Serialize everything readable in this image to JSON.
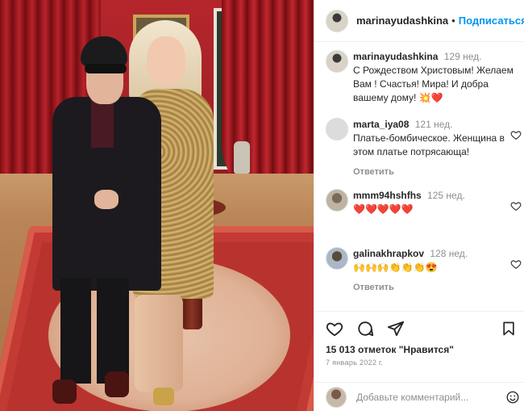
{
  "post": {
    "username": "marinayudashkina",
    "follow_label": "Подписаться",
    "separator": "•"
  },
  "comments": [
    {
      "username": "marinayudashkina",
      "time": "129 нед.",
      "text": "С Рождеством Христовым! Желаем Вам ! Счастья! Мира! И добра вашему дому! 💥❤️",
      "reply_label": ""
    },
    {
      "username": "marta_iya08",
      "time": "121 нед.",
      "text": "Платье-бомбическое. Женщина в этом платье потрясающа!",
      "reply_label": "Ответить"
    },
    {
      "username": "mmm94hshfhs",
      "time": "125 нед.",
      "text": "❤️❤️❤️❤️❤️",
      "reply_label": ""
    },
    {
      "username": "galinakhrapkov",
      "time": "128 нед.",
      "text": "🙌🙌🙌👏👏👏😍",
      "reply_label": "Ответить"
    }
  ],
  "actions": {
    "likes_text": "15 013 отметок \"Нравится\"",
    "date_text": "7 январь 2022 г."
  },
  "add_comment": {
    "placeholder": "Добавьте комментарий..."
  },
  "icons": {
    "like": "heart-icon",
    "comment": "comment-icon",
    "share": "share-icon",
    "save": "bookmark-icon",
    "emoji": "emoji-icon"
  },
  "colors": {
    "link_blue": "#0095f6",
    "muted": "#8e8e8e",
    "heart_red": "#ed4956"
  }
}
